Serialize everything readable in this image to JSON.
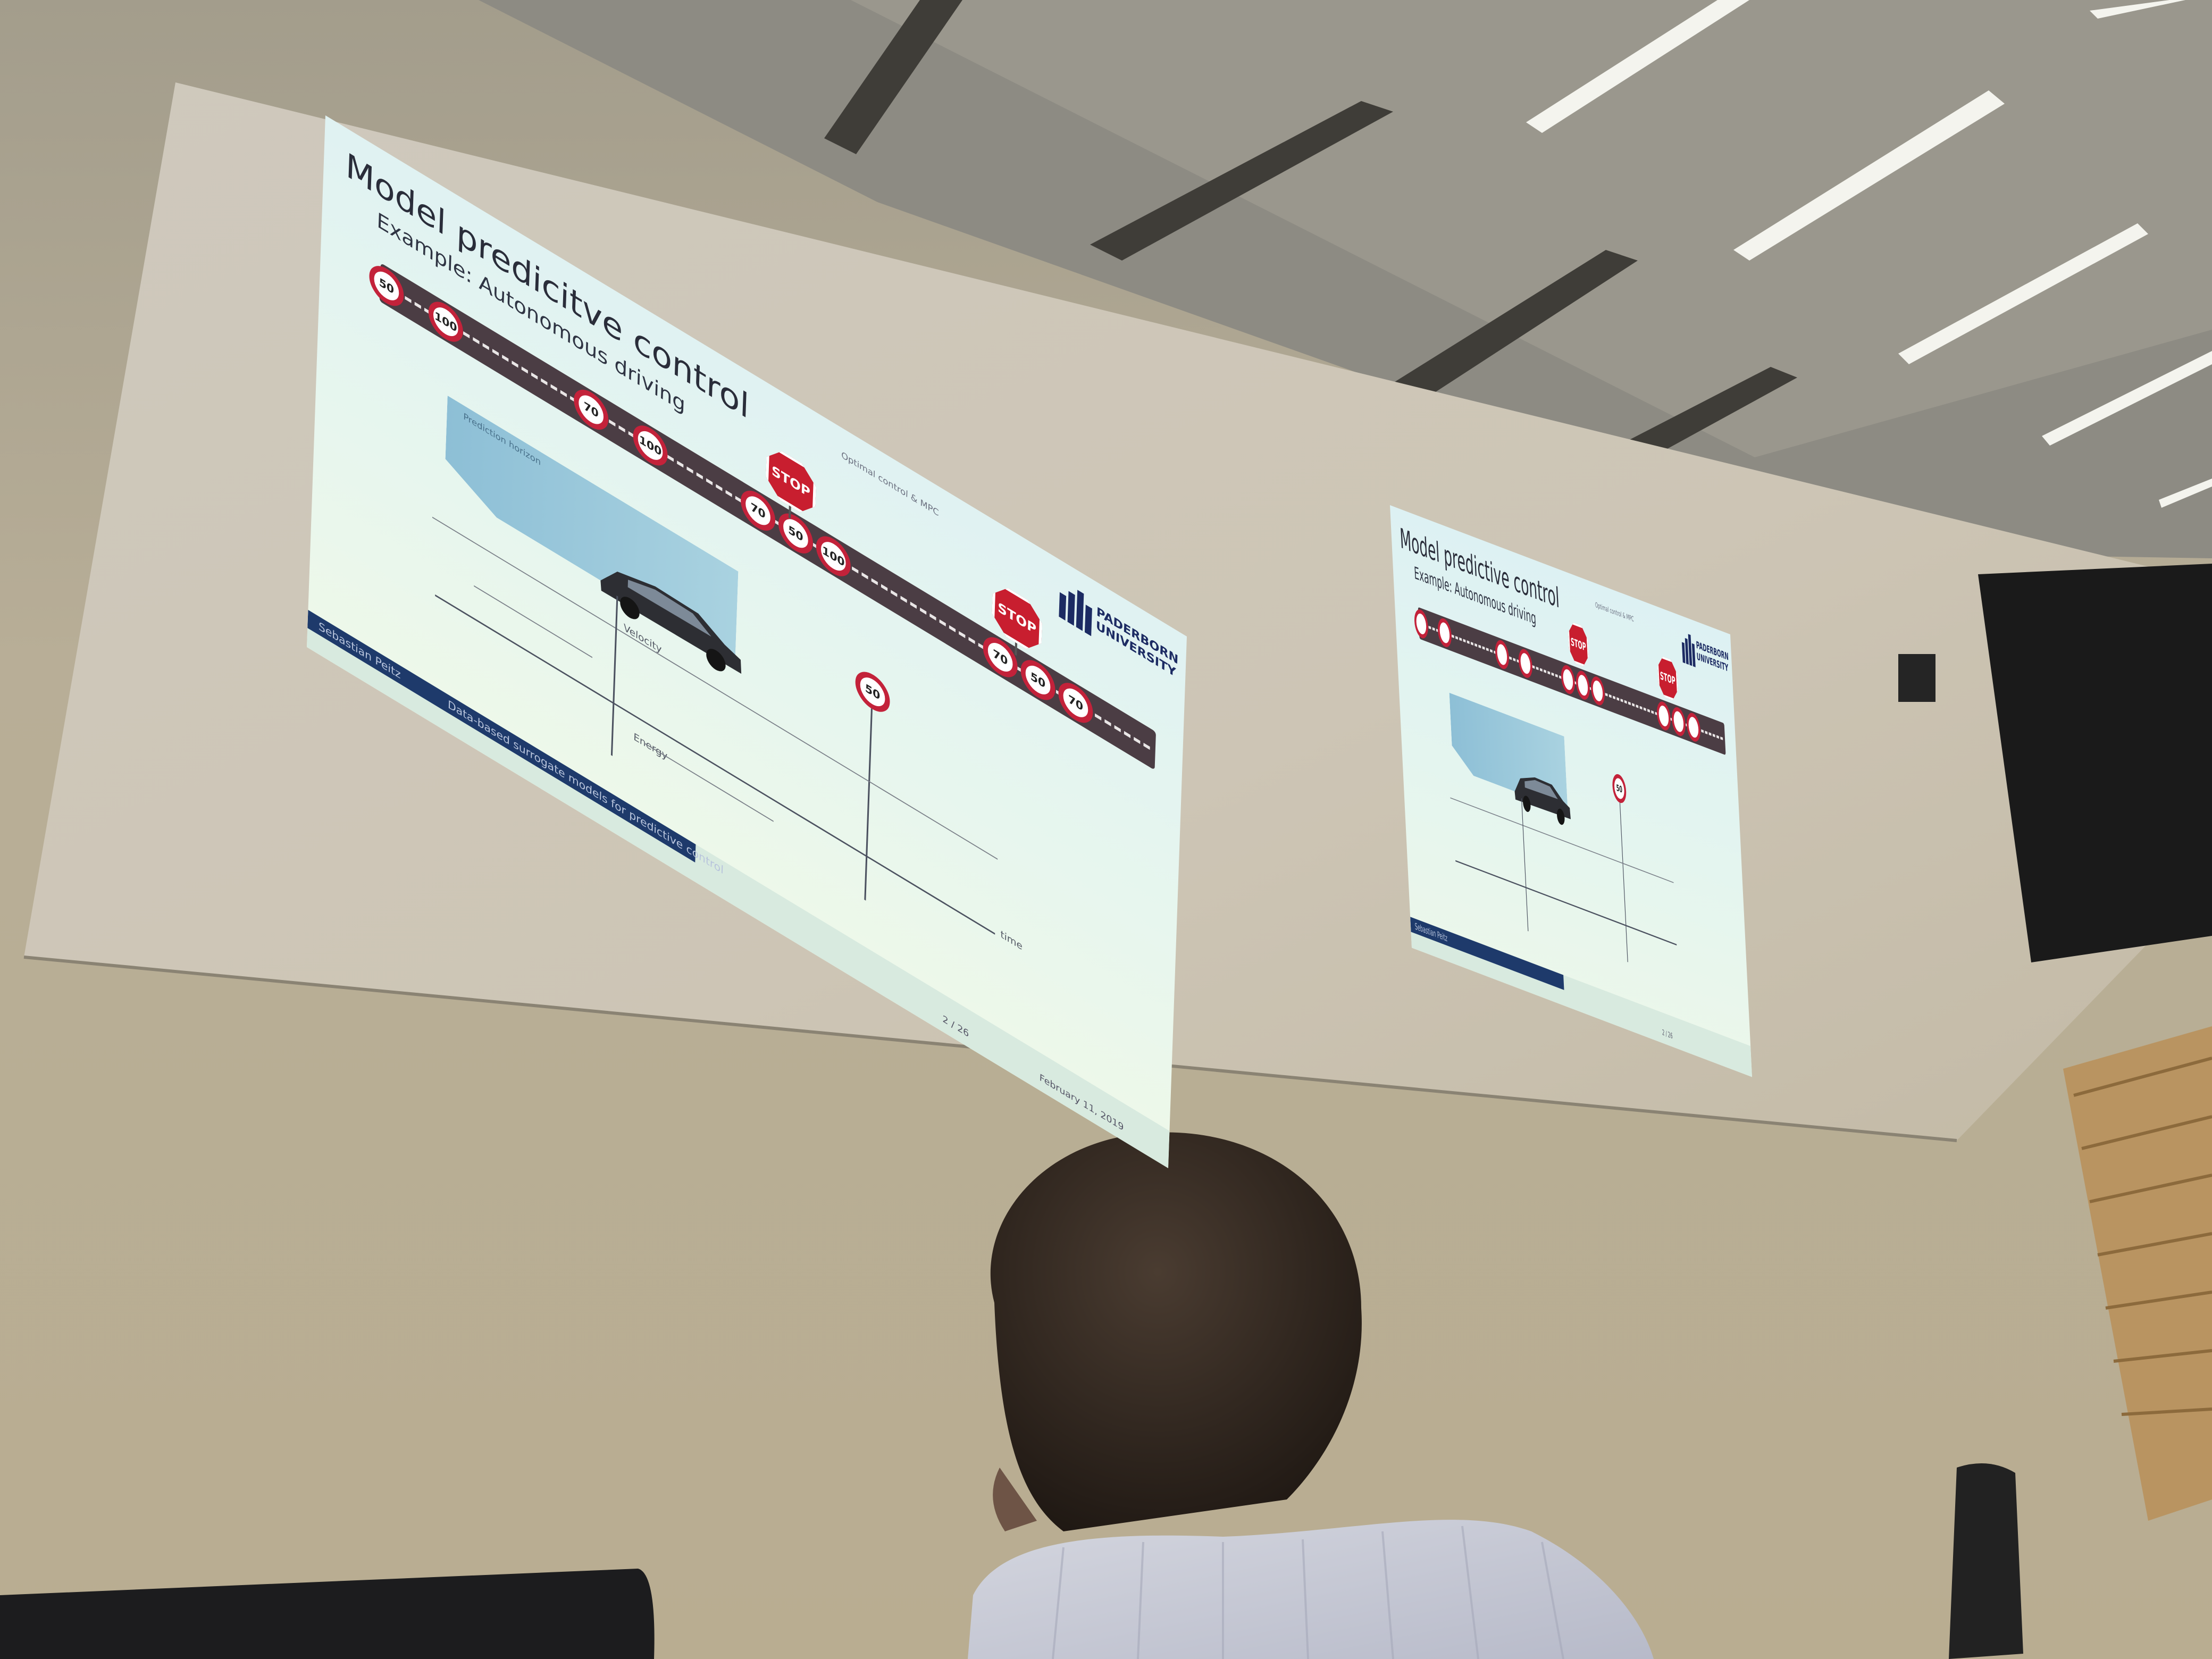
{
  "slide_left": {
    "title": "Model predicitve control",
    "subtitle": "Example: Autonomous driving",
    "section": "Optimal control & MPC",
    "logo": {
      "line1": "PADERBORN",
      "line2": "UNIVERSITY"
    },
    "road_signs": [
      "50",
      "100",
      "70",
      "100",
      "70",
      "50",
      "100",
      "70",
      "50",
      "70"
    ],
    "stop_label": "STOP",
    "horizon_label": "Prediction horizon",
    "post_sign": "50",
    "velocity_label": "Velocity",
    "energy_label": "Energy",
    "time_label": "time",
    "footer": {
      "author": "Sebastian Peitz",
      "talk_title": "Data-based surrogate models for predictive control",
      "page": "2 / 26",
      "date": "February 11, 2019"
    }
  },
  "slide_right": {
    "title": "Model predictive control",
    "subtitle": "Example: Autonomous driving",
    "section": "Optimal control & MPC",
    "logo": {
      "line1": "PADERBORN",
      "line2": "UNIVERSITY"
    },
    "stop_label": "STOP",
    "post_sign": "50",
    "footer": {
      "author": "Sebastian Peitz",
      "page": "2 / 26"
    }
  },
  "colors": {
    "wall": "#b4ab96",
    "ceiling": "#8f8c82",
    "slide_bg": "#e4f5ef",
    "road": "#4b3d44",
    "sign_red": "#c3223a",
    "uni_blue": "#1c2b63",
    "shirt": "#d7dae6",
    "hair": "#3b2f26"
  }
}
